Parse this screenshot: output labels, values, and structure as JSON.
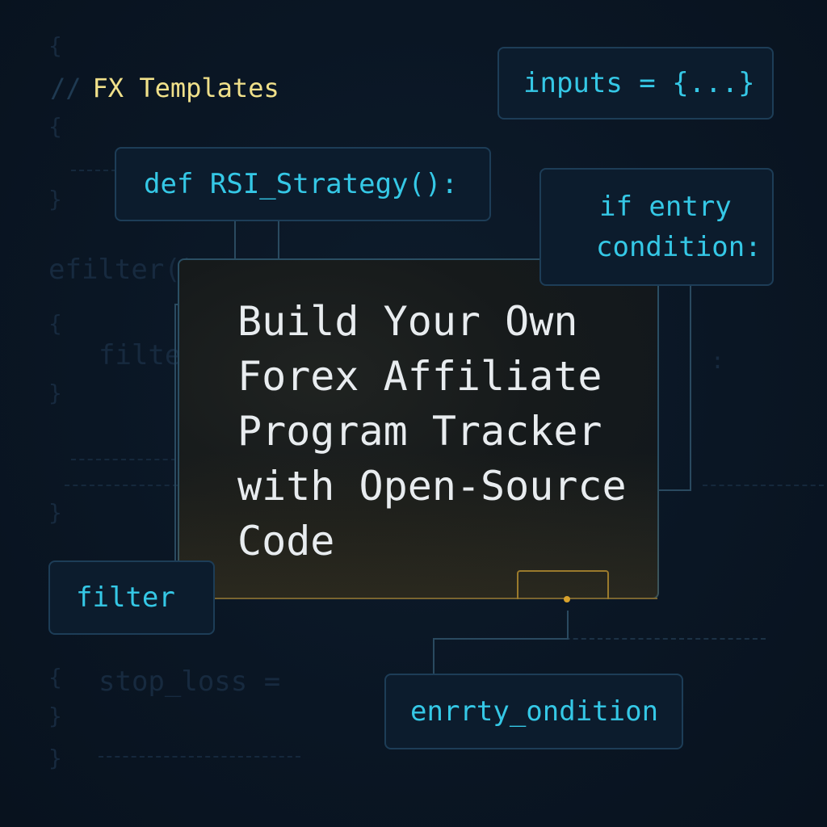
{
  "brand": {
    "comment": "//",
    "label": "FX Templates"
  },
  "chips": {
    "inputs": "inputs = {...}",
    "def": "def RSI_Strategy():",
    "if_line1": "if entry",
    "if_line2": "condition:",
    "filter": "filter",
    "entry": "enrrty_ondition"
  },
  "title": {
    "line1": "Build Your Own",
    "line2": "Forex Affiliate",
    "line3": "Program Tracker",
    "line4": "with Open-Source",
    "line5": "Code"
  },
  "background_code": {
    "efilter": "efilter()",
    "filte": "filte",
    "stop_loss": "stop_loss ="
  },
  "colors": {
    "background": "#0a1523",
    "chip_text": "#35c8e6",
    "brand_text": "#f0e08a",
    "title_text": "#e8ecef",
    "accent_gold": "#d8a22c"
  }
}
